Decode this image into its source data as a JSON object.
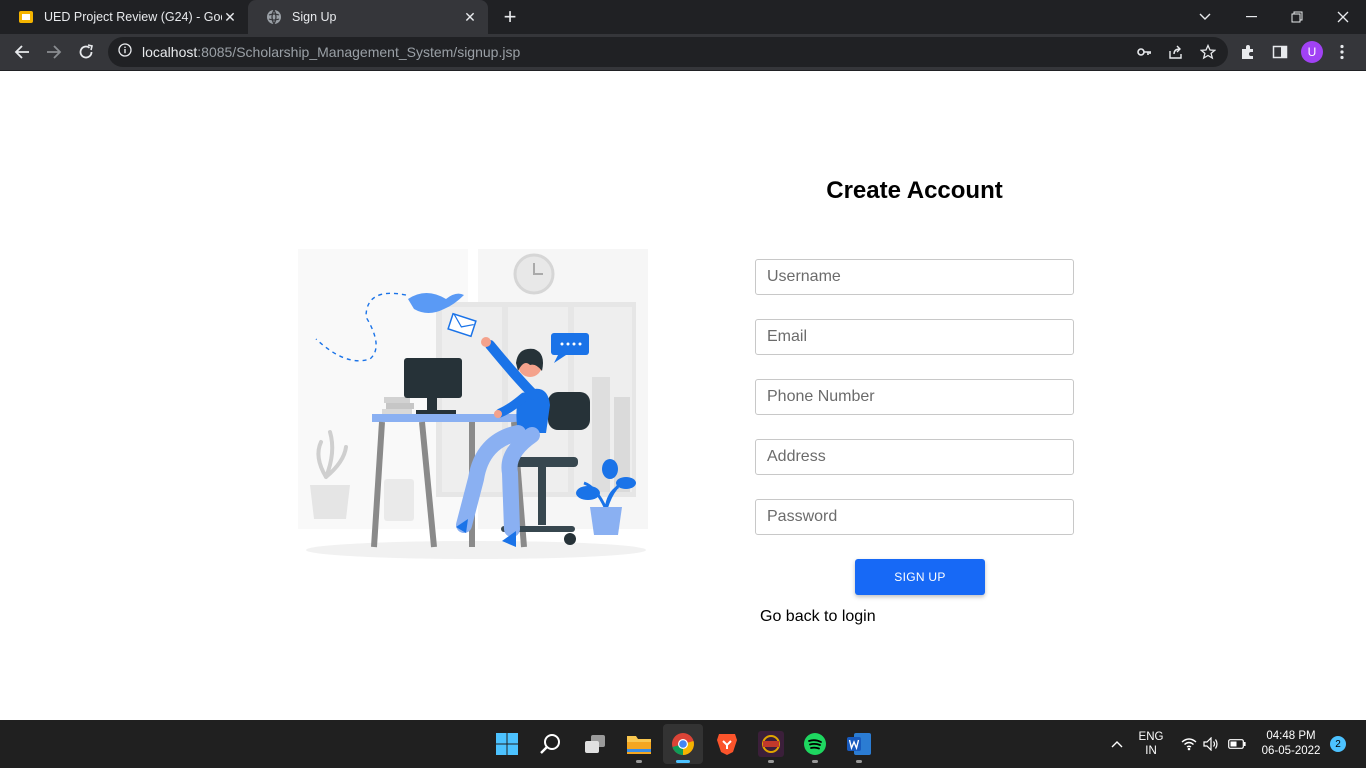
{
  "browser": {
    "tabs": [
      {
        "title": "UED Project Review (G24) - Goog",
        "active": false,
        "favicon": "slides-icon"
      },
      {
        "title": "Sign Up",
        "active": true,
        "favicon": "globe-icon"
      }
    ],
    "url_host": "localhost",
    "url_path": ":8085/Scholarship_Management_System/signup.jsp",
    "profile_initial": "U"
  },
  "form": {
    "heading": "Create Account",
    "username_placeholder": "Username",
    "email_placeholder": "Email",
    "phone_placeholder": "Phone Number",
    "address_placeholder": "Address",
    "password_placeholder": "Password",
    "signup_label": "SIGN UP",
    "back_link": "Go back to login"
  },
  "taskbar": {
    "apps": [
      "windows-start-icon",
      "search-icon",
      "task-view-icon",
      "file-explorer-icon",
      "chrome-icon",
      "brave-icon",
      "game-icon",
      "spotify-icon",
      "word-icon"
    ],
    "language_line1": "ENG",
    "language_line2": "IN",
    "time": "04:48 PM",
    "date": "06-05-2022",
    "notification_count": "2"
  },
  "colors": {
    "accent": "#1769f6",
    "illustration_blue": "#1a73e8",
    "chrome_dark": "#202124",
    "toolbar": "#35363a"
  }
}
